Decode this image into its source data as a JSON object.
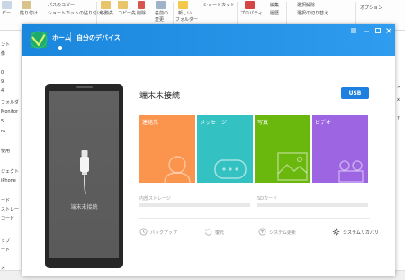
{
  "explorer": {
    "ribbon": {
      "items": [
        {
          "label": "ピー"
        },
        {
          "label": "貼り付け"
        },
        {
          "label": "パスのコピー"
        },
        {
          "label": "ショートカットの貼り付け"
        },
        {
          "label": "移動先"
        },
        {
          "label": "コピー先"
        },
        {
          "label": "削除"
        },
        {
          "label": "名前の"
        },
        {
          "label": "変更"
        },
        {
          "label": "新しい"
        },
        {
          "label": "フォルダー"
        },
        {
          "label": "ショートカット"
        },
        {
          "label": "プロパティ"
        },
        {
          "label": "編集"
        },
        {
          "label": "履歴"
        },
        {
          "label": "選択解除"
        },
        {
          "label": "選択の切り替え"
        },
        {
          "label": "オプション"
        }
      ]
    },
    "nav_items": [
      "ント",
      "像",
      "",
      "0",
      "9",
      "4",
      "フォルダ",
      "Monitor",
      "5",
      "ra",
      "",
      "使用",
      "",
      "ジェクト",
      "iPhone",
      "",
      "ード",
      "ストレー",
      "コード",
      "",
      "ップ",
      "ード",
      "",
      "ク"
    ],
    "right_items": [
      "^",
      "x",
      "?"
    ]
  },
  "app": {
    "tabs": [
      {
        "label": "ホーム",
        "active": true
      },
      {
        "label": "自分のデバイス",
        "active": false
      }
    ],
    "window_controls": [
      "menu-icon",
      "minimize-icon",
      "maximize-icon",
      "close-icon"
    ],
    "device": {
      "status_text": "端末未接続",
      "screen_caption": "端末未接続"
    },
    "usb_button": "USB",
    "tiles": [
      {
        "label": "連絡先",
        "color": "#fb944d"
      },
      {
        "label": "メッセージ",
        "color": "#33c1c1"
      },
      {
        "label": "写真",
        "color": "#6ab70e"
      },
      {
        "label": "ビデオ",
        "color": "#9d65e2"
      }
    ],
    "storage": {
      "internal_label": "内部ストレージ",
      "internal_fill": 0,
      "sd_label": "SDカード",
      "sd_fill": 0
    },
    "actions": [
      {
        "label": "バックアップ",
        "icon": "backup-icon"
      },
      {
        "label": "復元",
        "icon": "restore-icon"
      },
      {
        "label": "システム更新",
        "icon": "system-update-icon"
      },
      {
        "label": "システムリカバリ",
        "icon": "system-recovery-icon"
      }
    ]
  }
}
